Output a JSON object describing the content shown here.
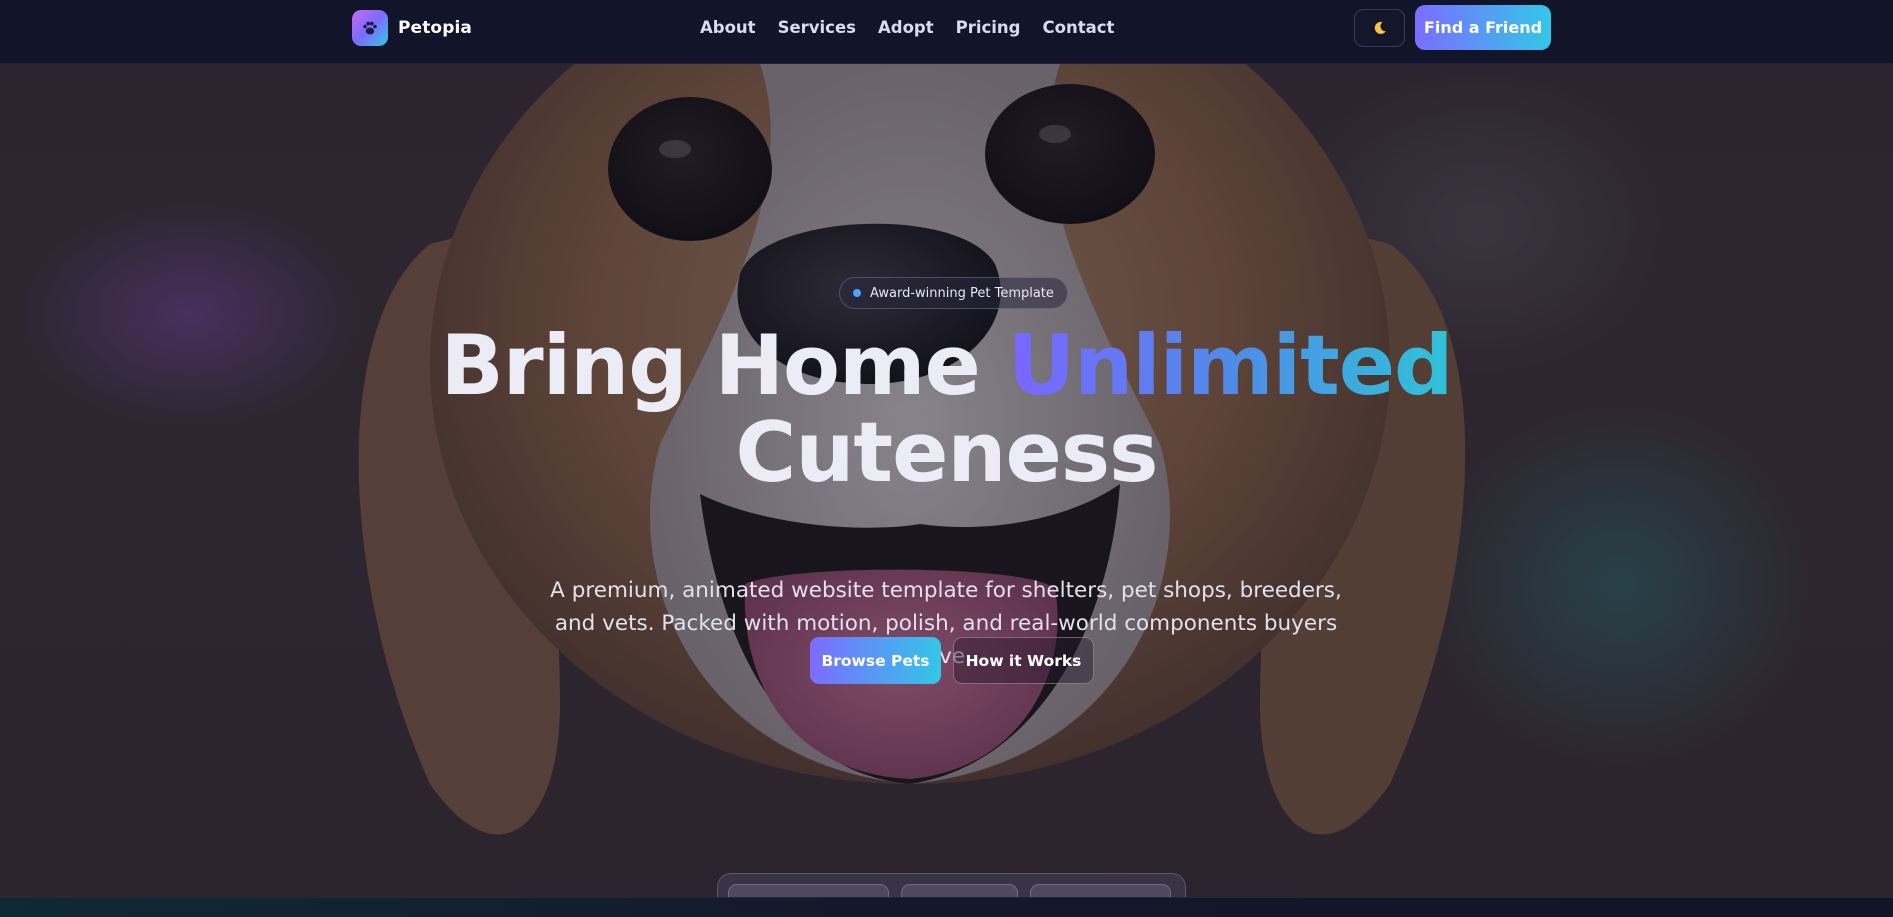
{
  "brand": {
    "name": "Petopia",
    "logo_icon": "paw-icon"
  },
  "nav": {
    "links": [
      "About",
      "Services",
      "Adopt",
      "Pricing",
      "Contact"
    ]
  },
  "header_actions": {
    "theme_toggle_icon": "moon-icon",
    "theme_toggle_glyph": "🌙",
    "cta_label": "Find a Friend"
  },
  "hero": {
    "badge_text": "Award-winning Pet Template",
    "title_part1": "Bring Home ",
    "title_accent": "Unlimited",
    "title_part2": "Cuteness",
    "subtitle": "A premium, animated website template for shelters, pet shops, breeders, and vets. Packed with motion, polish, and real-world components buyers love.",
    "primary_button": "Browse Pets",
    "secondary_button": "How it Works"
  },
  "colors": {
    "nav_bg": "#121429",
    "accent_start": "#7b6cff",
    "accent_end": "#33c8e8",
    "badge_dot": "#4aa6ff"
  }
}
